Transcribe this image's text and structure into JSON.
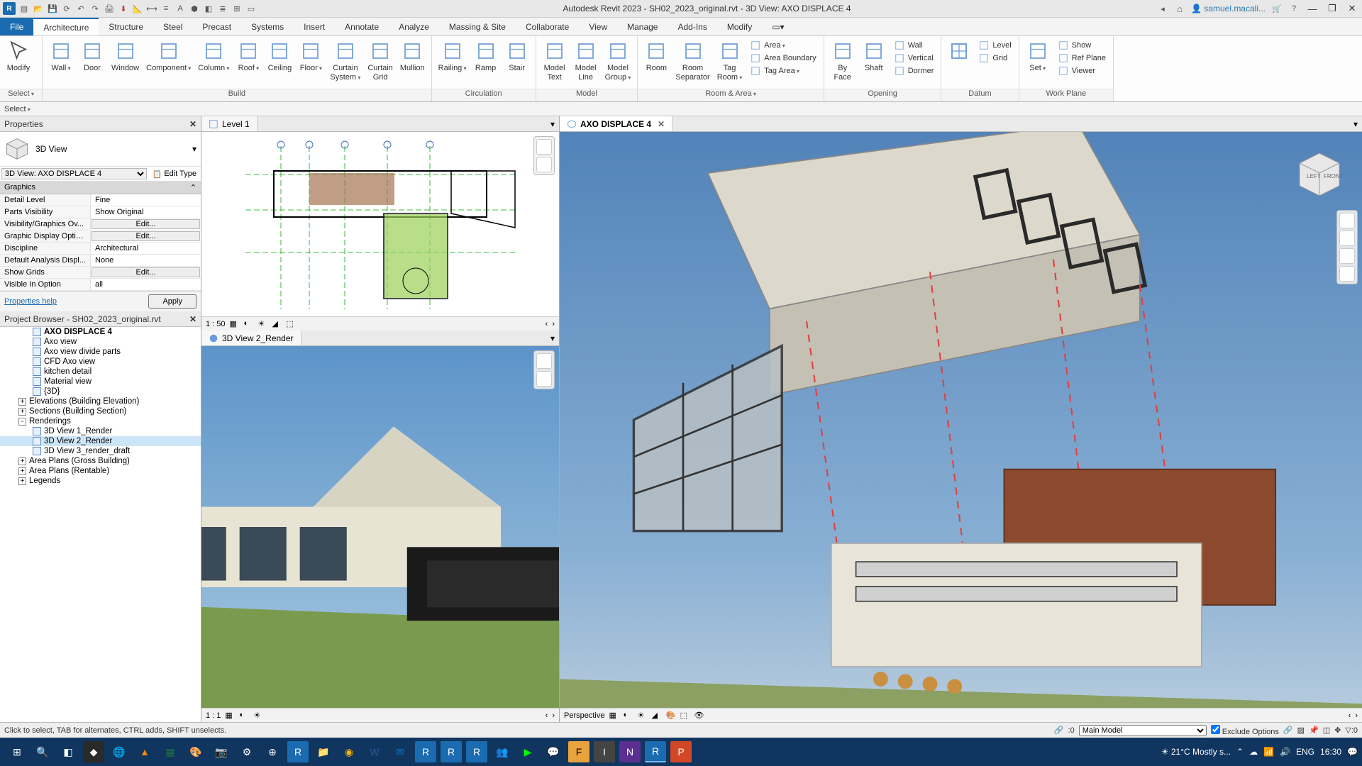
{
  "title": "Autodesk Revit 2023 - SH02_2023_original.rvt - 3D View: AXO DISPLACE 4",
  "user": "samuel.macali...",
  "tabs": {
    "file": "File",
    "list": [
      "Architecture",
      "Structure",
      "Steel",
      "Precast",
      "Systems",
      "Insert",
      "Annotate",
      "Analyze",
      "Massing & Site",
      "Collaborate",
      "View",
      "Manage",
      "Add-Ins",
      "Modify"
    ],
    "active": "Architecture"
  },
  "ribbon": {
    "modify": "Modify",
    "select": "Select",
    "build": {
      "label": "Build",
      "items": [
        "Wall",
        "Door",
        "Window",
        "Component",
        "Column",
        "Roof",
        "Ceiling",
        "Floor",
        "Curtain\nSystem",
        "Curtain\nGrid",
        "Mullion"
      ]
    },
    "circulation": {
      "label": "Circulation",
      "items": [
        "Railing",
        "Ramp",
        "Stair"
      ]
    },
    "model": {
      "label": "Model",
      "items": [
        "Model\nText",
        "Model\nLine",
        "Model\nGroup"
      ]
    },
    "roomarea": {
      "label": "Room & Area",
      "items": [
        "Room",
        "Room\nSeparator",
        "Tag\nRoom"
      ],
      "small": [
        "Area",
        "Area Boundary",
        "Tag Area"
      ]
    },
    "opening": {
      "label": "Opening",
      "items": [
        "By\nFace",
        "Shaft"
      ],
      "small": [
        "Wall",
        "Vertical",
        "Dormer"
      ]
    },
    "datum": {
      "label": "Datum",
      "small": [
        "Level",
        "Grid"
      ]
    },
    "workplane": {
      "label": "Work Plane",
      "items": [
        "Set"
      ],
      "small": [
        "Show",
        "Ref Plane",
        "Viewer"
      ]
    }
  },
  "properties": {
    "title": "Properties",
    "type": "3D View",
    "instance": "3D View: AXO DISPLACE 4",
    "editType": "Edit Type",
    "section": "Graphics",
    "rows": [
      {
        "label": "Detail Level",
        "value": "Fine"
      },
      {
        "label": "Parts Visibility",
        "value": "Show Original"
      },
      {
        "label": "Visibility/Graphics Ov...",
        "button": "Edit..."
      },
      {
        "label": "Graphic Display Optio...",
        "button": "Edit..."
      },
      {
        "label": "Discipline",
        "value": "Architectural"
      },
      {
        "label": "Default Analysis Displ...",
        "value": "None"
      },
      {
        "label": "Show Grids",
        "button": "Edit..."
      },
      {
        "label": "Visible In Option",
        "value": "all"
      }
    ],
    "help": "Properties help",
    "apply": "Apply"
  },
  "browser": {
    "title": "Project Browser - SH02_2023_original.rvt",
    "views": [
      "AXO DISPLACE 4",
      "Axo view",
      "Axo view divide parts",
      "CFD Axo view",
      "kitchen detail",
      "Material view",
      "{3D}"
    ],
    "cats": [
      {
        "expand": "+",
        "label": "Elevations (Building Elevation)"
      },
      {
        "expand": "+",
        "label": "Sections (Building Section)"
      },
      {
        "expand": "-",
        "label": "Renderings",
        "children": [
          "3D View 1_Render",
          "3D View 2_Render",
          "3D View 3_render_draft"
        ]
      },
      {
        "expand": "+",
        "label": "Area Plans (Gross Building)"
      },
      {
        "expand": "+",
        "label": "Area Plans (Rentable)"
      },
      {
        "expand": "+",
        "label": "Legends"
      }
    ]
  },
  "views": {
    "level1": {
      "name": "Level 1",
      "scale": "1 : 50"
    },
    "render": {
      "name": "3D View 2_Render",
      "scale": "1 : 1"
    },
    "axo": {
      "name": "AXO DISPLACE 4",
      "scale": "Perspective"
    }
  },
  "status": {
    "hint": "Click to select, TAB for alternates, CTRL adds, SHIFT unselects.",
    "zero": ":0",
    "model": "Main Model",
    "exclude": "Exclude Options",
    "filter": ":0"
  },
  "taskbar": {
    "weather": "21°C  Mostly s...",
    "lang": "ENG",
    "time": "16:30"
  }
}
